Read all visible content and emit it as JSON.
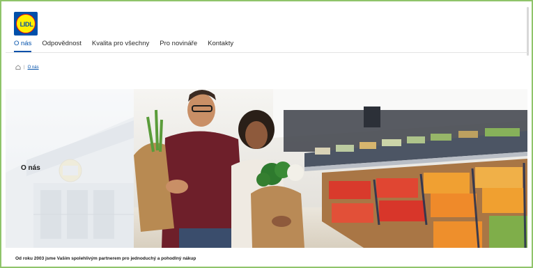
{
  "brand": {
    "logo_text": "LIDL",
    "colors": {
      "blue": "#0050aa",
      "yellow": "#fff000",
      "red": "#e60a14"
    }
  },
  "nav": {
    "items": [
      {
        "label": "O nás",
        "active": true
      },
      {
        "label": "Odpovědnost",
        "active": false
      },
      {
        "label": "Kvalita pro všechny",
        "active": false
      },
      {
        "label": "Pro novináře",
        "active": false
      },
      {
        "label": "Kontakty",
        "active": false
      }
    ]
  },
  "breadcrumb": {
    "home_icon": "home-icon",
    "separator": "|",
    "current": "O nás"
  },
  "hero": {
    "title": "O nás"
  },
  "tagline": "Od roku 2003 jsme Vaším spolehlivým partnerem pro jednoduchý a pohodlný nákup"
}
